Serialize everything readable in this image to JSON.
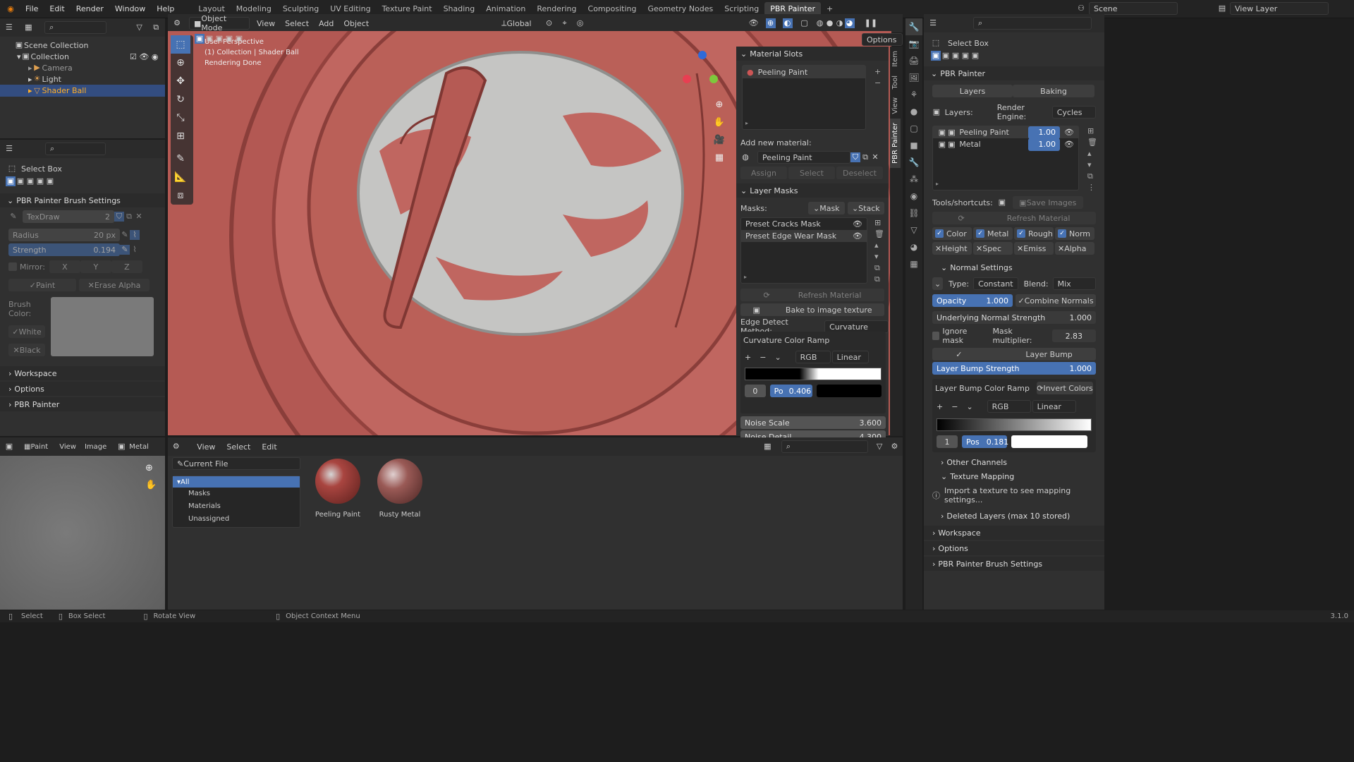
{
  "menu": [
    "File",
    "Edit",
    "Render",
    "Window",
    "Help"
  ],
  "workspaces": [
    "Layout",
    "Modeling",
    "Sculpting",
    "UV Editing",
    "Texture Paint",
    "Shading",
    "Animation",
    "Rendering",
    "Compositing",
    "Geometry Nodes",
    "Scripting",
    "PBR Painter"
  ],
  "scene": "Scene",
  "view_layer": "View Layer",
  "outliner": {
    "root": "Scene Collection",
    "collection": "Collection",
    "items": [
      "Camera",
      "Light",
      "Shader Ball"
    ]
  },
  "tool_panel": {
    "active_tool": "Select Box",
    "brush_title": "PBR Painter Brush Settings",
    "brush_name": "TexDraw",
    "brush_users": "2",
    "radius_label": "Radius",
    "radius": "20 px",
    "strength_label": "Strength",
    "strength": "0.194",
    "mirror_label": "Mirror:",
    "x": "X",
    "y": "Y",
    "z": "Z",
    "paint": "Paint",
    "erase_alpha": "Erase Alpha",
    "brush_color": "Brush Color:",
    "white": "White",
    "black": "Black",
    "sections": [
      "Workspace",
      "Options",
      "PBR Painter"
    ]
  },
  "viewport": {
    "mode": "Object Mode",
    "menus": [
      "View",
      "Select",
      "Add",
      "Object"
    ],
    "orientation": "Global",
    "options": "Options",
    "info": [
      "User Perspective",
      "(1) Collection | Shader Ball",
      "Rendering Done"
    ],
    "tabs": [
      "Item",
      "Tool",
      "View",
      "PBR Painter"
    ]
  },
  "material_panel": {
    "slots_title": "Material Slots",
    "slot": "Peeling Paint",
    "add_label": "Add new material:",
    "material": "Peeling Paint",
    "assign": "Assign",
    "select": "Select",
    "deselect": "Deselect",
    "masks_title": "Layer Masks",
    "masks_label": "Masks:",
    "mask_btn": "Mask",
    "stack_btn": "Stack",
    "masks": [
      "Preset Cracks Mask",
      "Preset Edge Wear Mask"
    ],
    "refresh": "Refresh Material",
    "bake": "Bake to image texture",
    "edge_label": "Edge Detect Method:",
    "edge": "Curvature",
    "ramp_title": "Curvature Color Ramp",
    "ramp_mode": "RGB",
    "ramp_interp": "Linear",
    "ramp_index": "0",
    "ramp_pos_label": "Po",
    "ramp_pos": "0.406",
    "noise_scale_label": "Noise Scale",
    "noise_scale": "3.600",
    "noise_detail_label": "Noise Detail",
    "noise_detail": "4.300"
  },
  "bottom": {
    "paint_mode": "Paint",
    "menus": [
      "View",
      "Image"
    ],
    "image": "Metal",
    "asset_menus": [
      "View",
      "Select",
      "Edit"
    ],
    "library": "Current File",
    "categories": [
      "All",
      "Masks",
      "Materials",
      "Unassigned"
    ],
    "assets": [
      "Peeling Paint",
      "Rusty Metal"
    ]
  },
  "props": {
    "active_tool": "Select Box",
    "title": "PBR Painter",
    "tab_layers": "Layers",
    "tab_baking": "Baking",
    "layers_label": "Layers:",
    "engine_label": "Render Engine:",
    "engine": "Cycles",
    "layers": [
      {
        "name": "Peeling Paint",
        "value": "1.00"
      },
      {
        "name": "Metal",
        "value": "1.00"
      }
    ],
    "tools_label": "Tools/shortcuts:",
    "save_images": "Save Images",
    "refresh": "Refresh Material",
    "channels_on": [
      "Color",
      "Metal",
      "Rough",
      "Norm"
    ],
    "channels_off": [
      "Height",
      "Spec",
      "Emiss",
      "Alpha"
    ],
    "normal_settings": "Normal Settings",
    "type_label": "Type:",
    "type": "Constant",
    "blend_label": "Blend:",
    "blend": "Mix",
    "opacity_label": "Opacity",
    "opacity": "1.000",
    "combine": "Combine Normals",
    "uns_label": "Underlying Normal Strength",
    "uns": "1.000",
    "ignore_mask": "Ignore mask",
    "mask_mult_label": "Mask multiplier:",
    "mask_mult": "2.83",
    "layer_bump": "Layer Bump",
    "bump_strength_label": "Layer Bump Strength",
    "bump_strength": "1.000",
    "bump_ramp": "Layer Bump Color Ramp",
    "invert": "Invert Colors",
    "ramp_mode": "RGB",
    "ramp_interp": "Linear",
    "ramp_index": "1",
    "ramp_pos_label": "Pos",
    "ramp_pos": "0.181",
    "other_channels": "Other Channels",
    "texture_mapping": "Texture Mapping",
    "import_hint": "Import a texture to see mapping settings...",
    "deleted_layers": "Deleted Layers (max 10 stored)",
    "sections": [
      "Workspace",
      "Options",
      "PBR Painter Brush Settings"
    ]
  },
  "status": {
    "select": "Select",
    "box_select": "Box Select",
    "rotate": "Rotate View",
    "context": "Object Context Menu",
    "version": "3.1.0"
  }
}
